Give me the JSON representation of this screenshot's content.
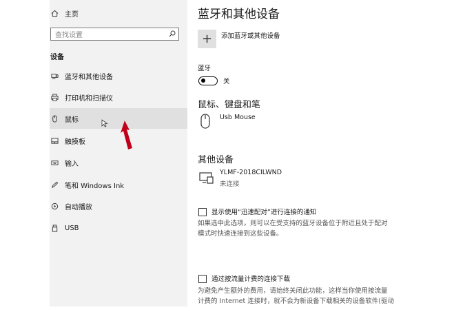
{
  "sidebar": {
    "home_label": "主页",
    "search_placeholder": "查找设置",
    "section": "设备",
    "items": [
      {
        "label": "蓝牙和其他设备",
        "icon": "bluetooth-devices-icon"
      },
      {
        "label": "打印机和扫描仪",
        "icon": "printer-icon"
      },
      {
        "label": "鼠标",
        "icon": "mouse-icon"
      },
      {
        "label": "触摸板",
        "icon": "touchpad-icon"
      },
      {
        "label": "输入",
        "icon": "keyboard-icon"
      },
      {
        "label": "笔和 Windows Ink",
        "icon": "pen-icon"
      },
      {
        "label": "自动播放",
        "icon": "autoplay-icon"
      },
      {
        "label": "USB",
        "icon": "usb-icon"
      }
    ],
    "selected_index": 2
  },
  "main": {
    "title": "蓝牙和其他设备",
    "add_device_label": "添加蓝牙或其他设备",
    "bluetooth_label": "蓝牙",
    "bluetooth_state": "关",
    "mouse_section": "鼠标、键盘和笔",
    "mouse_device": "Usb Mouse",
    "other_section": "其他设备",
    "other_device_name": "YLMF-2018CILWND",
    "other_device_status": "未连接",
    "swift_pair_label": "显示使用“迅速配对”进行连接的通知",
    "swift_pair_desc_1": "如果选中此选项，则可以在受支持的蓝牙设备位于附近且处于配对",
    "swift_pair_desc_2": "模式时快速连接到这些设备。",
    "metered_label": "通过按流量计费的连接下载",
    "metered_desc_1": "为避免产生额外的费用，请始终关闭此功能，这样当你使用按流量",
    "metered_desc_2": "计费的 Internet 连接时，就不会为新设备下载相关的设备软件(驱动"
  },
  "colors": {
    "sidebar_bg": "#f2f2f2",
    "selected_bg": "#e0e0e0",
    "pointer": "#c0001a"
  }
}
